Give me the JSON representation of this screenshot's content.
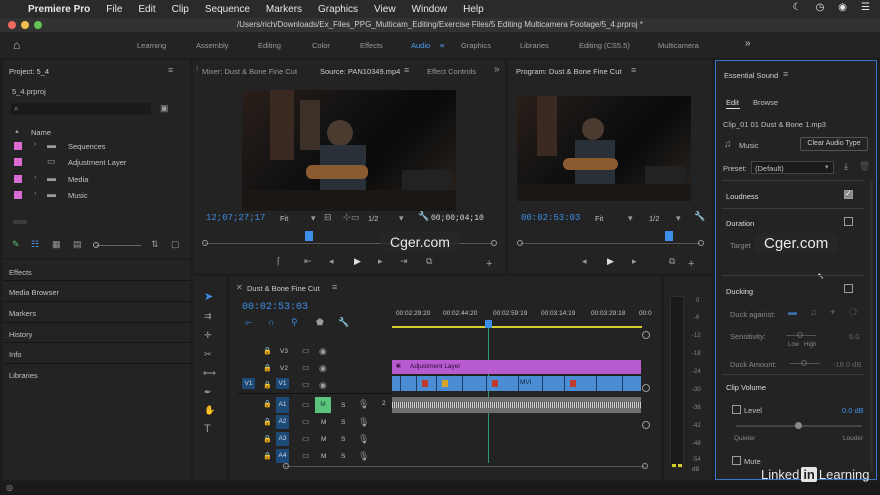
{
  "menubar": {
    "app": "Premiere Pro",
    "items": [
      "File",
      "Edit",
      "Clip",
      "Sequence",
      "Markers",
      "Graphics",
      "View",
      "Window",
      "Help"
    ]
  },
  "titlebar": {
    "path": "/Users/rich/Downloads/Ex_Files_PPG_Multicam_Editing/Exercise Files/5 Editing Multicamera Footage/5_4.prproj *"
  },
  "workspaces": {
    "items": [
      "Learning",
      "Assembly",
      "Editing",
      "Color",
      "Effects",
      "Audio",
      "Graphics",
      "Libraries",
      "Editing (CS5.5)",
      "Multicamera"
    ],
    "active": "Audio",
    "more": "»"
  },
  "project": {
    "title": "Project: 5_4",
    "filename": "5_4.prproj",
    "column_name": "Name",
    "items": [
      {
        "label": "Sequences",
        "type": "folder",
        "color": "#d86cd3"
      },
      {
        "label": "Adjustment Layer",
        "type": "file",
        "color": "#d86cd3"
      },
      {
        "label": "Media",
        "type": "folder",
        "color": "#d86cd3"
      },
      {
        "label": "Music",
        "type": "folder",
        "color": "#d86cd3"
      }
    ],
    "panels": [
      "Effects",
      "Media Browser",
      "Markers",
      "History",
      "Info",
      "Libraries"
    ]
  },
  "source": {
    "tabs": [
      "Mixer: Dust & Bone Fine Cut",
      "Source: PAN10349.mp4",
      "Effect Controls"
    ],
    "timecode": "12;07;27;17",
    "fit": "Fit",
    "resolution": "1/2",
    "duration": "00;00;04;10"
  },
  "program": {
    "title": "Program: Dust & Bone Fine Cut",
    "timecode": "00:02:53:03",
    "fit": "Fit",
    "resolution": "1/2"
  },
  "timeline": {
    "title": "Dust & Bone Fine Cut",
    "timecode": "00:02:53:03",
    "ruler": [
      "00:02:29:20",
      "00:02:44:20",
      "00:02:59:19",
      "00:03:14:19",
      "00:03:29:18",
      "00:0"
    ],
    "video_tracks": [
      "V3",
      "V2",
      "V1"
    ],
    "audio_tracks": [
      "A1",
      "A2",
      "A3",
      "A4"
    ],
    "v1_source": "V1",
    "adjustment_clip": "Adjustment Layer",
    "v1_clip": "MVI",
    "m": "M",
    "s": "S",
    "audio_level": "2",
    "meter_scale": [
      "0",
      "-6",
      "-12",
      "-18",
      "-24",
      "-30",
      "-36",
      "-42",
      "-48",
      "-54"
    ],
    "meter_db": "dB"
  },
  "essential_sound": {
    "title": "Essential Sound",
    "tabs": [
      "Edit",
      "Browse"
    ],
    "clip": "Clip_01 01 Dust & Bone 1.mp3",
    "type": "Music",
    "clear_button": "Clear Audio Type",
    "preset_label": "Preset:",
    "preset_value": "(Default)",
    "loudness": "Loudness",
    "duration": "Duration",
    "target": "Target",
    "ducking": "Ducking",
    "duck_against": "Duck against:",
    "sensitivity": "Sensitivity:",
    "sensitivity_value": "6.0",
    "low": "Low",
    "high": "High",
    "duck_amount": "Duck Amount:",
    "duck_amount_value": "-18.0 dB",
    "clip_volume": "Clip Volume",
    "level": "Level",
    "level_value": "0.0 dB",
    "quieter": "Quieter",
    "louder": "Louder",
    "mute": "Mute",
    "loudness_checked": true
  },
  "watermarks": [
    "Cger.com",
    "Cger.com"
  ],
  "branding": {
    "linkedin": "Linked",
    "in": "in",
    "learning": "Learning"
  },
  "colors": {
    "accent": "#3d8ee8",
    "clip_purple": "#b95bd0",
    "clip_blue": "#4a8dd4",
    "label": "#d86cd3",
    "mute_green": "#5bc47a"
  }
}
